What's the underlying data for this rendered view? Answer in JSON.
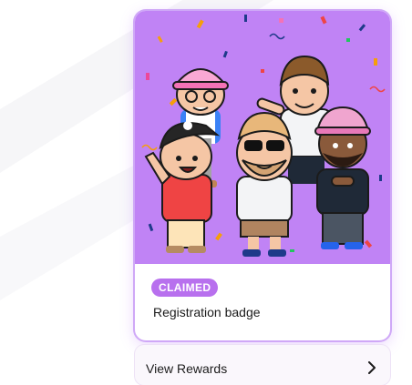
{
  "badge": {
    "status": "CLAIMED",
    "name": "Registration badge",
    "artwork_icon": "group-of-cartoon-characters-with-confetti",
    "colors": {
      "art_background": "#c083f5",
      "status_pill": "#b870ee",
      "card_border": "#cfa8f7"
    }
  },
  "rewards": {
    "label": "View Rewards",
    "icon": "chevron-right-icon"
  }
}
